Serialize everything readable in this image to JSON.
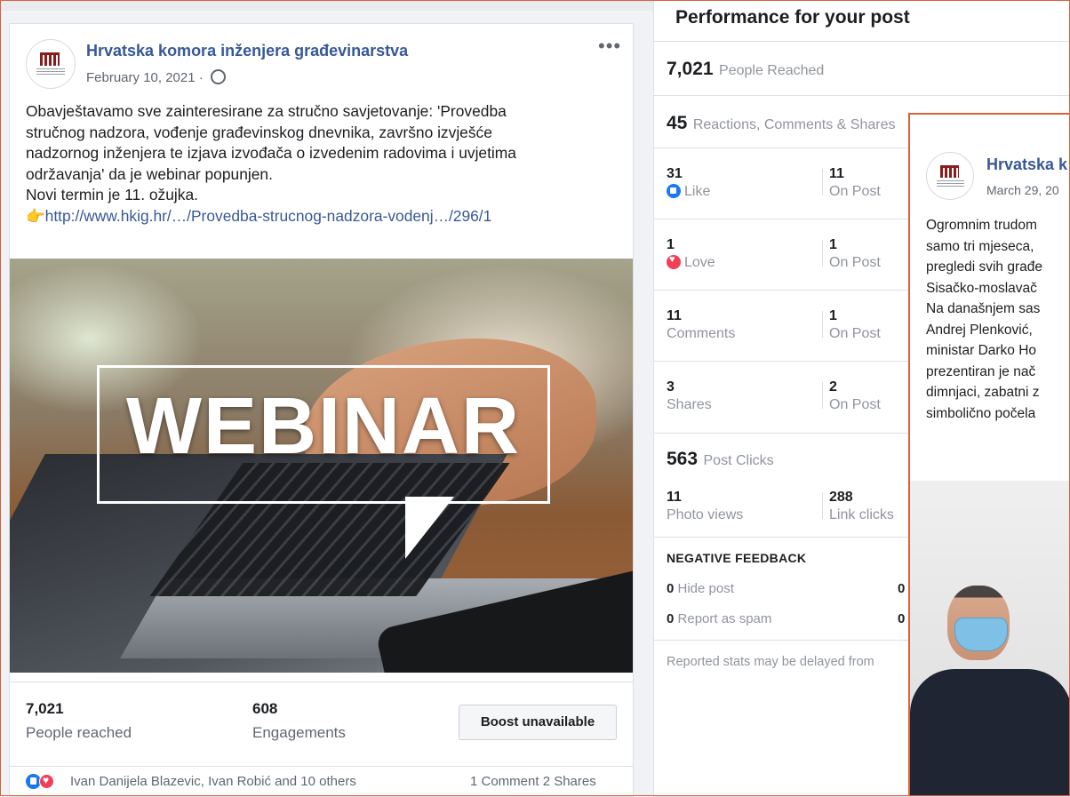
{
  "post": {
    "page_name": "Hrvatska komora inženjera građevinarstva",
    "date": "February 10, 2021 ·",
    "more_label": "•••",
    "text_lines": [
      "Obavještavamo sve zainteresirane za stručno savjetovanje: 'Provedba",
      "stručnog nadzora, vođenje građevinskog dnevnika, završno izvješće",
      "nadzornog inženjera te izjava izvođača o izvedenim radovima i uvjetima",
      "održavanja' da je webinar popunjen.",
      "Novi termin je 11. ožujka."
    ],
    "link_emoji": "👉",
    "link_text": "http://www.hkig.hr/…/Provedba-strucnog-nadzora-vodenj…/296/1",
    "image_text": "WEBINAR",
    "stats": {
      "reached_value": "7,021",
      "reached_label": "People reached",
      "engagements_value": "608",
      "engagements_label": "Engagements",
      "boost_label": "Boost unavailable"
    },
    "reactions_names": "Ivan Danijela Blazevic, Ivan Robić and 10 others",
    "comments_shares": "1 Comment  2 Shares"
  },
  "performance": {
    "title": "Performance for your post",
    "people_reached": {
      "value": "7,021",
      "label": "People Reached"
    },
    "reactions_total": {
      "value": "45",
      "label": "Reactions, Comments & Shares"
    },
    "breakdown": [
      {
        "value": "31",
        "label": "Like",
        "on_value": "11",
        "on_label": "On Post"
      },
      {
        "value": "1",
        "label": "Love",
        "on_value": "1",
        "on_label": "On Post"
      },
      {
        "value": "11",
        "label": "Comments",
        "on_value": "1",
        "on_label": "On Post"
      },
      {
        "value": "3",
        "label": "Shares",
        "on_value": "2",
        "on_label": "On Post"
      }
    ],
    "post_clicks": {
      "value": "563",
      "label": "Post Clicks"
    },
    "clicks_breakdown": [
      {
        "value": "11",
        "label": "Photo views"
      },
      {
        "value": "288",
        "label": "Link clicks"
      }
    ],
    "negative_title": "NEGATIVE FEEDBACK",
    "negative": [
      {
        "value": "0",
        "label": "Hide post",
        "right_value": "0"
      },
      {
        "value": "0",
        "label": "Report as spam",
        "right_value": "0"
      }
    ],
    "footnote": "Reported stats may be delayed from"
  },
  "overlay_post": {
    "page_name": "Hrvatska k",
    "date": "March 29, 20",
    "text_lines": [
      "Ogromnim trudom",
      "samo tri mjeseca,",
      "pregledi svih građe",
      "Sisačko-moslavač",
      "Na današnjem sas",
      "Andrej Plenković,",
      "ministar Darko Ho",
      "prezentiran je nač",
      "dimnjaci, zabatni z",
      "simbolično počela"
    ]
  }
}
